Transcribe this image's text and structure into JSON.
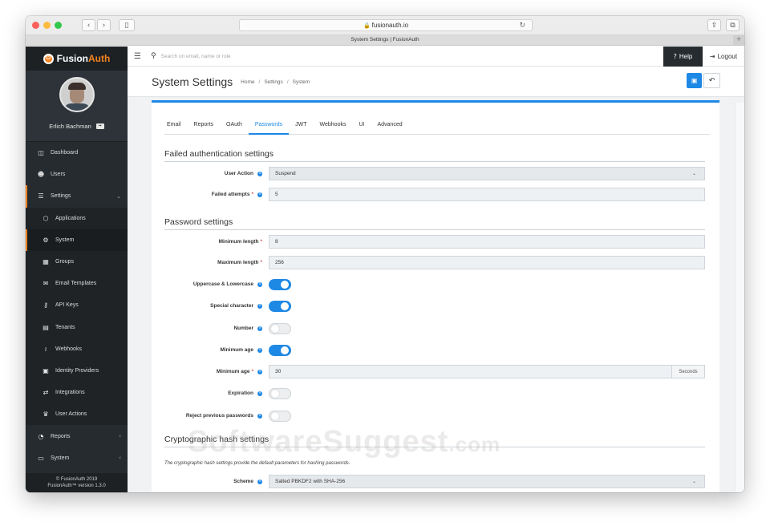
{
  "browser": {
    "url": "fusionauth.io",
    "tab_title": "System Settings | FusionAuth",
    "back_icon": "chevron-left-icon",
    "forward_icon": "chevron-right-icon",
    "sidebar_icon": "sidebar-toggle-icon",
    "new_tab": "+",
    "colors": {
      "close": "#fc605c",
      "minimize": "#fdbc40",
      "zoom": "#34c84a"
    }
  },
  "brand": {
    "name_prefix": "Fusion",
    "name_suffix": "Auth",
    "accent": "#f58320"
  },
  "user": {
    "name": "Erlich Bachman"
  },
  "sidebar": {
    "items": [
      {
        "label": "Dashboard",
        "icon": "dashboard-icon",
        "glyph": "◫"
      },
      {
        "label": "Users",
        "icon": "users-icon",
        "glyph": "👥"
      },
      {
        "label": "Settings",
        "icon": "settings-sliders-icon",
        "glyph": "☰",
        "chevron": "⌄"
      },
      {
        "label": "Applications",
        "icon": "cube-icon",
        "glyph": "⬡"
      },
      {
        "label": "System",
        "icon": "gear-icon",
        "glyph": "⚙"
      },
      {
        "label": "Groups",
        "icon": "groups-icon",
        "glyph": "▦"
      },
      {
        "label": "Email Templates",
        "icon": "envelope-icon",
        "glyph": "✉"
      },
      {
        "label": "API Keys",
        "icon": "key-icon",
        "glyph": "⚷"
      },
      {
        "label": "Tenants",
        "icon": "building-icon",
        "glyph": "▤"
      },
      {
        "label": "Webhooks",
        "icon": "rss-icon",
        "glyph": "≀"
      },
      {
        "label": "Identity Providers",
        "icon": "id-badge-icon",
        "glyph": "▣"
      },
      {
        "label": "Integrations",
        "icon": "exchange-icon",
        "glyph": "⇄"
      },
      {
        "label": "User Actions",
        "icon": "trophy-icon",
        "glyph": "♛"
      },
      {
        "label": "Reports",
        "icon": "pie-chart-icon",
        "glyph": "◔",
        "chevron": "‹"
      },
      {
        "label": "System",
        "icon": "desktop-icon",
        "glyph": "▭",
        "chevron": "‹"
      }
    ],
    "footer_line1": "© FusionAuth 2019",
    "footer_line2": "FusionAuth™ version 1.3.0"
  },
  "topbar": {
    "search_placeholder": "Search on email, name or role",
    "help_label": "Help",
    "logout_label": "Logout"
  },
  "header": {
    "title": "System Settings",
    "breadcrumb": [
      "Home",
      "Settings",
      "System"
    ],
    "breadcrumb_sep": "/"
  },
  "tabs": [
    "Email",
    "Reports",
    "OAuth",
    "Passwords",
    "JWT",
    "Webhooks",
    "UI",
    "Advanced"
  ],
  "active_tab": "Passwords",
  "failed_auth": {
    "title": "Failed authentication settings",
    "user_action_label": "User Action",
    "user_action_value": "Suspend",
    "failed_attempts_label": "Failed attempts",
    "failed_attempts_value": "5"
  },
  "password": {
    "title": "Password settings",
    "min_length_label": "Minimum length",
    "min_length_value": "8",
    "max_length_label": "Maximum length",
    "max_length_value": "256",
    "uppercase_label": "Uppercase & Lowercase",
    "uppercase_on": true,
    "special_label": "Special character",
    "special_on": true,
    "number_label": "Number",
    "number_on": false,
    "min_age_toggle_label": "Minimum age",
    "min_age_toggle_on": true,
    "min_age_label": "Minimum age",
    "min_age_value": "30",
    "min_age_unit": "Seconds",
    "expiration_label": "Expiration",
    "expiration_on": false,
    "reject_label": "Reject previous passwords",
    "reject_on": false
  },
  "crypto": {
    "title": "Cryptographic hash settings",
    "description": "The cryptographic hash settings provide the default parameters for hashing passwords.",
    "scheme_label": "Scheme",
    "scheme_value": "Salted PBKDF2 with SHA-256"
  },
  "watermark": {
    "main": "SoftwareSuggest",
    "suffix": ".com"
  }
}
